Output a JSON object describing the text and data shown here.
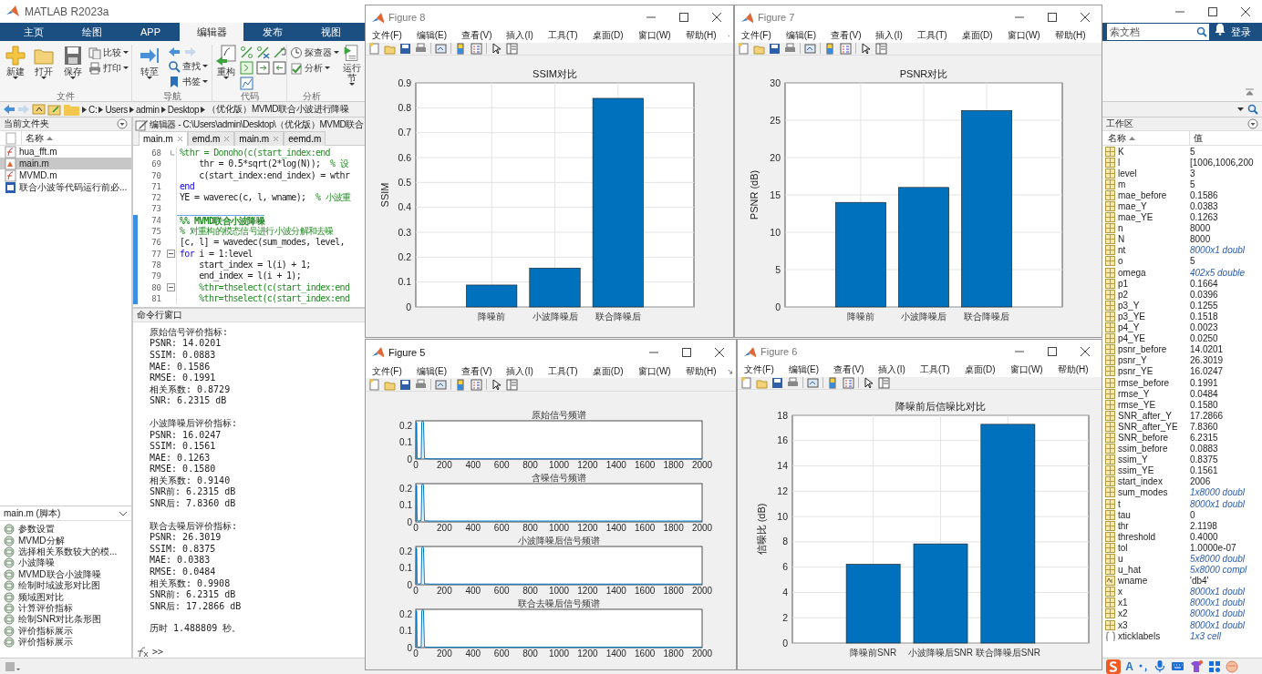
{
  "window": {
    "title": "MATLAB R2023a"
  },
  "toolstrip_tabs": [
    {
      "label": "主页",
      "selected": false
    },
    {
      "label": "绘图",
      "selected": false
    },
    {
      "label": "APP",
      "selected": false
    },
    {
      "label": "编辑器",
      "selected": true
    },
    {
      "label": "发布",
      "selected": false
    },
    {
      "label": "视图",
      "selected": false
    }
  ],
  "search": {
    "placeholder": "索文档"
  },
  "sign_in": "登录",
  "ribbon": [
    {
      "kind": "file",
      "label": "文件",
      "buttons": [
        {
          "label": "新建",
          "kind": "large"
        },
        {
          "label": "打开",
          "kind": "large"
        },
        {
          "label": "保存",
          "kind": "large"
        },
        {
          "label": "比较",
          "kind": "small"
        },
        {
          "label": "打印",
          "kind": "small"
        }
      ]
    },
    {
      "kind": "nav",
      "label": "导航",
      "buttons": [
        {
          "label": "转至",
          "kind": "large"
        },
        {
          "label": "查找",
          "kind": "small"
        },
        {
          "label": "书签",
          "kind": "small"
        }
      ]
    },
    {
      "kind": "code",
      "label": "代码",
      "buttons": [
        {
          "label": "重构",
          "kind": "large"
        }
      ]
    },
    {
      "kind": "analyze",
      "label": "分析",
      "buttons": [
        {
          "label": "探查器",
          "kind": "small"
        },
        {
          "label": "分析",
          "kind": "small"
        }
      ]
    },
    {
      "kind": "run",
      "buttons": [
        {
          "label": "运行节",
          "kind": "large"
        }
      ]
    }
  ],
  "address": [
    "C:",
    "Users",
    "admin",
    "Desktop",
    "（优化版）MVMD联合小波进行降噪"
  ],
  "current_folder": {
    "title": "当前文件夹",
    "column": "名称",
    "files": [
      {
        "name": "hua_fft.m",
        "kind": "function",
        "selected": false
      },
      {
        "name": "main.m",
        "kind": "script",
        "selected": true
      },
      {
        "name": "MVMD.m",
        "kind": "function",
        "selected": false
      },
      {
        "name": "联合小波等代码运行前必...",
        "kind": "document",
        "selected": false
      }
    ]
  },
  "details": {
    "title": "main.m (脚本)",
    "sections": [
      "参数设置",
      "MVMD分解",
      "选择相关系数较大的模...",
      "小波降噪",
      "MVMD联合小波降噪",
      "绘制时域波形对比图",
      "频域图对比",
      "计算评价指标",
      "绘制SNR对比条形图",
      "评价指标展示",
      "评价指标展示"
    ]
  },
  "editor": {
    "title": "编辑器 - C:\\Users\\admin\\Desktop\\（优化版）MVMD联合",
    "tabs": [
      {
        "label": "main.m",
        "selected": true
      },
      {
        "label": "emd.m",
        "selected": false
      },
      {
        "label": "main.m",
        "selected": false
      },
      {
        "label": "eemd.m",
        "selected": false
      }
    ],
    "lines": [
      {
        "number": "68",
        "fold_toggle": false,
        "fold_end": true,
        "active_cell": false,
        "parts": [
          {
            "kind": "comment",
            "text": "%thr = Donoho(c(start_index:end"
          }
        ]
      },
      {
        "number": "69",
        "fold_toggle": false,
        "fold_end": false,
        "active_cell": false,
        "parts": [
          {
            "kind": "code",
            "text": "    thr = 0.5*sqrt(2*log(N));  "
          },
          {
            "kind": "comment",
            "text": "% 设"
          }
        ]
      },
      {
        "number": "70",
        "fold_toggle": false,
        "fold_end": false,
        "active_cell": false,
        "parts": [
          {
            "kind": "code",
            "text": "    c(start_index:end_index) = wthr"
          }
        ]
      },
      {
        "number": "71",
        "fold_toggle": false,
        "fold_end": false,
        "active_cell": false,
        "parts": [
          {
            "kind": "keyword",
            "text": "end"
          }
        ]
      },
      {
        "number": "72",
        "fold_toggle": false,
        "fold_end": false,
        "active_cell": false,
        "parts": [
          {
            "kind": "code",
            "text": "YE = waverec(c, l, wname);  "
          },
          {
            "kind": "comment",
            "text": "% 小波重"
          }
        ]
      },
      {
        "number": "73",
        "fold_toggle": false,
        "fold_end": false,
        "active_cell": false
      },
      {
        "number": "74",
        "fold_toggle": false,
        "fold_end": false,
        "active_cell": true,
        "parts": [
          {
            "kind": "section",
            "text": "%% MVMD联合小波降噪"
          }
        ]
      },
      {
        "number": "75",
        "fold_toggle": false,
        "fold_end": false,
        "active_cell": true,
        "parts": [
          {
            "kind": "comment",
            "text": "% 对重构的模态信号进行小波分解和去噪"
          }
        ]
      },
      {
        "number": "76",
        "fold_toggle": false,
        "fold_end": false,
        "active_cell": true,
        "parts": [
          {
            "kind": "code",
            "text": "[c, l] = wavedec(sum_modes, level,"
          }
        ]
      },
      {
        "number": "77",
        "fold_toggle": true,
        "fold_end": false,
        "active_cell": true,
        "parts": [
          {
            "kind": "keyword",
            "text": "for"
          },
          {
            "kind": "code",
            "text": " i = 1:level"
          }
        ]
      },
      {
        "number": "78",
        "fold_toggle": false,
        "fold_end": false,
        "active_cell": true,
        "parts": [
          {
            "kind": "code",
            "text": "    start_index = l(i) + 1;"
          }
        ]
      },
      {
        "number": "79",
        "fold_toggle": false,
        "fold_end": false,
        "active_cell": true,
        "parts": [
          {
            "kind": "code",
            "text": "    end_index = l(i + 1);"
          }
        ]
      },
      {
        "number": "80",
        "fold_toggle": true,
        "fold_end": false,
        "active_cell": true,
        "parts": [
          {
            "kind": "comment",
            "text": "    %thr=thselect(c(start_index:end"
          }
        ]
      },
      {
        "number": "81",
        "fold_toggle": false,
        "fold_end": false,
        "active_cell": true,
        "parts": [
          {
            "kind": "comment",
            "text": "    %thr=thselect(c(start_index:end"
          }
        ]
      }
    ]
  },
  "command_window": {
    "title": "命令行窗口",
    "blocks": [
      [
        "原始信号评价指标:",
        "PSNR: 14.0201",
        "SSIM: 0.0883",
        "MAE: 0.1586",
        "RMSE: 0.1991",
        "相关系数: 0.8729",
        "SNR: 6.2315 dB"
      ],
      [
        "小波降噪后评价指标:",
        "PSNR: 16.0247",
        "SSIM: 0.1561",
        "MAE: 0.1263",
        "RMSE: 0.1580",
        "相关系数: 0.9140",
        "SNR前: 6.2315 dB",
        "SNR后: 7.8360 dB"
      ],
      [
        "联合去噪后评价指标:",
        "PSNR: 26.3019",
        "SSIM: 0.8375",
        "MAE: 0.0383",
        "RMSE: 0.0484",
        "相关系数: 0.9908",
        "SNR前: 6.2315 dB",
        "SNR后: 17.2866 dB"
      ],
      [
        "历时 1.488809 秒。"
      ]
    ],
    "prompt": ">>"
  },
  "workspace": {
    "title": "工作区",
    "columns": [
      "名称",
      "值"
    ],
    "rows": [
      {
        "name": "K",
        "value": "5",
        "kind": "scalar"
      },
      {
        "name": "l",
        "value": "[1006,1006,200",
        "kind": "scalar"
      },
      {
        "name": "level",
        "value": "3",
        "kind": "scalar"
      },
      {
        "name": "m",
        "value": "5",
        "kind": "scalar"
      },
      {
        "name": "mae_before",
        "value": "0.1586",
        "kind": "scalar"
      },
      {
        "name": "mae_Y",
        "value": "0.0383",
        "kind": "scalar"
      },
      {
        "name": "mae_YE",
        "value": "0.1263",
        "kind": "scalar"
      },
      {
        "name": "n",
        "value": "8000",
        "kind": "scalar"
      },
      {
        "name": "N",
        "value": "8000",
        "kind": "scalar"
      },
      {
        "name": "nt",
        "value": "8000x1 doubl",
        "kind": "array"
      },
      {
        "name": "o",
        "value": "5",
        "kind": "scalar"
      },
      {
        "name": "omega",
        "value": "402x5 double",
        "kind": "array"
      },
      {
        "name": "p1",
        "value": "0.1664",
        "kind": "scalar"
      },
      {
        "name": "p2",
        "value": "0.0396",
        "kind": "scalar"
      },
      {
        "name": "p3_Y",
        "value": "0.1255",
        "kind": "scalar"
      },
      {
        "name": "p3_YE",
        "value": "0.1518",
        "kind": "scalar"
      },
      {
        "name": "p4_Y",
        "value": "0.0023",
        "kind": "scalar"
      },
      {
        "name": "p4_YE",
        "value": "0.0250",
        "kind": "scalar"
      },
      {
        "name": "psnr_before",
        "value": "14.0201",
        "kind": "scalar"
      },
      {
        "name": "psnr_Y",
        "value": "26.3019",
        "kind": "scalar"
      },
      {
        "name": "psnr_YE",
        "value": "16.0247",
        "kind": "scalar"
      },
      {
        "name": "rmse_before",
        "value": "0.1991",
        "kind": "scalar"
      },
      {
        "name": "rmse_Y",
        "value": "0.0484",
        "kind": "scalar"
      },
      {
        "name": "rmse_YE",
        "value": "0.1580",
        "kind": "scalar"
      },
      {
        "name": "SNR_after_Y",
        "value": "17.2866",
        "kind": "scalar"
      },
      {
        "name": "SNR_after_YE",
        "value": "7.8360",
        "kind": "scalar"
      },
      {
        "name": "SNR_before",
        "value": "6.2315",
        "kind": "scalar"
      },
      {
        "name": "ssim_before",
        "value": "0.0883",
        "kind": "scalar"
      },
      {
        "name": "ssim_Y",
        "value": "0.8375",
        "kind": "scalar"
      },
      {
        "name": "ssim_YE",
        "value": "0.1561",
        "kind": "scalar"
      },
      {
        "name": "start_index",
        "value": "2006",
        "kind": "scalar"
      },
      {
        "name": "sum_modes",
        "value": "1x8000 doubl",
        "kind": "array"
      },
      {
        "name": "t",
        "value": "8000x1 doubl",
        "kind": "array"
      },
      {
        "name": "tau",
        "value": "0",
        "kind": "scalar"
      },
      {
        "name": "thr",
        "value": "2.1198",
        "kind": "scalar"
      },
      {
        "name": "threshold",
        "value": "0.4000",
        "kind": "scalar"
      },
      {
        "name": "tol",
        "value": "1.0000e-07",
        "kind": "scalar"
      },
      {
        "name": "u",
        "value": "5x8000 doubl",
        "kind": "array"
      },
      {
        "name": "u_hat",
        "value": "5x8000 compl",
        "kind": "array"
      },
      {
        "name": "wname",
        "value": "'db4'",
        "kind": "char"
      },
      {
        "name": "x",
        "value": "8000x1 doubl",
        "kind": "array"
      },
      {
        "name": "x1",
        "value": "8000x1 doubl",
        "kind": "array"
      },
      {
        "name": "x2",
        "value": "8000x1 doubl",
        "kind": "array"
      },
      {
        "name": "x3",
        "value": "8000x1 doubl",
        "kind": "array"
      },
      {
        "name": "xticklabels",
        "value": "1x3 cell",
        "kind": "cell"
      }
    ]
  },
  "ime_toolbar": {
    "mode": "A"
  },
  "figures": [
    {
      "title": "Figure 8",
      "active": false,
      "menu": [
        "文件(F)",
        "编辑(E)",
        "查看(V)",
        "插入(I)",
        "工具(T)",
        "桌面(D)",
        "窗口(W)",
        "帮助(H)"
      ],
      "chart_data": {
        "type": "bar",
        "title": "SSIM对比",
        "ylabel": "SSIM",
        "categories": [
          "降噪前",
          "小波降噪后",
          "联合降噪后"
        ],
        "values": [
          0.088,
          0.156,
          0.838
        ],
        "grid": true,
        "ylim": [
          0,
          0.9
        ],
        "yticks": [
          0,
          0.1,
          0.2,
          0.3,
          0.4,
          0.5,
          0.6,
          0.7,
          0.8,
          0.9
        ]
      }
    },
    {
      "title": "Figure 7",
      "active": false,
      "menu": [
        "文件(F)",
        "编辑(E)",
        "查看(V)",
        "插入(I)",
        "工具(T)",
        "桌面(D)",
        "窗口(W)",
        "帮助(H)"
      ],
      "chart_data": {
        "type": "bar",
        "title": "PSNR对比",
        "ylabel": "PSNR (dB)",
        "categories": [
          "降噪前",
          "小波降噪后",
          "联合降噪后"
        ],
        "values": [
          14.0,
          16.0,
          26.3
        ],
        "grid": true,
        "ylim": [
          0,
          30
        ],
        "yticks": [
          0,
          5,
          10,
          15,
          20,
          25,
          30
        ]
      }
    },
    {
      "title": "Figure 5",
      "active": true,
      "menu": [
        "文件(F)",
        "编辑(E)",
        "查看(V)",
        "插入(I)",
        "工具(T)",
        "桌面(D)",
        "窗口(W)",
        "帮助(H)"
      ],
      "subplots": [
        {
          "chart_data": {
            "type": "line",
            "title": "原始信号频谱",
            "x": [
              0,
              3,
              6,
              9,
              20,
              38,
              42,
              48,
              54,
              60,
              100,
              2000
            ],
            "series": [
              {
                "color": "#0072bd",
                "values": [
                  0,
                  0.22,
                  0.22,
                  0.005,
                  0.002,
                  0.005,
                  0.22,
                  0.23,
                  0.22,
                  0.004,
                  0.001,
                  0.001
                ]
              }
            ],
            "xlim": [
              0,
              2000
            ],
            "ylim": [
              0,
              0.23
            ],
            "xticks": [
              0,
              200,
              400,
              600,
              800,
              1000,
              1200,
              1400,
              1600,
              1800,
              2000
            ],
            "yticks": [
              0,
              0.1,
              0.2
            ]
          }
        },
        {
          "chart_data": {
            "type": "line",
            "title": "含噪信号频谱",
            "x": [
              0,
              3,
              6,
              9,
              20,
              38,
              42,
              48,
              54,
              60,
              100,
              2000
            ],
            "series": [
              {
                "color": "#0072bd",
                "values": [
                  0.005,
                  0.22,
                  0.22,
                  0.008,
                  0.005,
                  0.008,
                  0.22,
                  0.23,
                  0.22,
                  0.007,
                  0.005,
                  0.005
                ]
              }
            ],
            "xlim": [
              0,
              2000
            ],
            "ylim": [
              0,
              0.23
            ],
            "xticks": [
              0,
              200,
              400,
              600,
              800,
              1000,
              1200,
              1400,
              1600,
              1800,
              2000
            ],
            "yticks": [
              0,
              0.1,
              0.2
            ]
          }
        },
        {
          "chart_data": {
            "type": "line",
            "title": "小波降噪后信号频谱",
            "x": [
              0,
              3,
              6,
              9,
              20,
              38,
              42,
              48,
              54,
              60,
              100,
              2000
            ],
            "series": [
              {
                "color": "#0072bd",
                "values": [
                  0.004,
                  0.22,
                  0.22,
                  0.007,
                  0.004,
                  0.007,
                  0.22,
                  0.23,
                  0.22,
                  0.006,
                  0.004,
                  0.004
                ]
              }
            ],
            "xlim": [
              0,
              2000
            ],
            "ylim": [
              0,
              0.23
            ],
            "xticks": [
              0,
              200,
              400,
              600,
              800,
              1000,
              1200,
              1400,
              1600,
              1800,
              2000
            ],
            "yticks": [
              0,
              0.1,
              0.2
            ]
          }
        },
        {
          "chart_data": {
            "type": "line",
            "title": "联合去噪后信号频谱",
            "x": [
              0,
              3,
              6,
              9,
              20,
              38,
              42,
              48,
              54,
              60,
              100,
              2000
            ],
            "series": [
              {
                "color": "#0072bd",
                "values": [
                  0.002,
                  0.22,
                  0.22,
                  0.005,
                  0.002,
                  0.005,
                  0.22,
                  0.23,
                  0.22,
                  0.004,
                  0.002,
                  0.002
                ]
              }
            ],
            "xlim": [
              0,
              2000
            ],
            "ylim": [
              0,
              0.23
            ],
            "xticks": [
              0,
              200,
              400,
              600,
              800,
              1000,
              1200,
              1400,
              1600,
              1800,
              2000
            ],
            "yticks": [
              0,
              0.1,
              0.2
            ]
          }
        }
      ]
    },
    {
      "title": "Figure 6",
      "active": false,
      "menu": [
        "文件(F)",
        "编辑(E)",
        "查看(V)",
        "插入(I)",
        "工具(T)",
        "桌面(D)",
        "窗口(W)",
        "帮助(H)"
      ],
      "chart_data": {
        "type": "bar",
        "title": "降噪前后信噪比对比",
        "ylabel": "信噪比 (dB)",
        "categories": [
          "降噪前SNR",
          "小波降噪后SNR",
          "联合降噪后SNR"
        ],
        "values": [
          6.23,
          7.84,
          17.29
        ],
        "grid": true,
        "ylim": [
          0,
          18
        ],
        "yticks": [
          0,
          2,
          4,
          6,
          8,
          10,
          12,
          14,
          16,
          18
        ]
      }
    }
  ]
}
